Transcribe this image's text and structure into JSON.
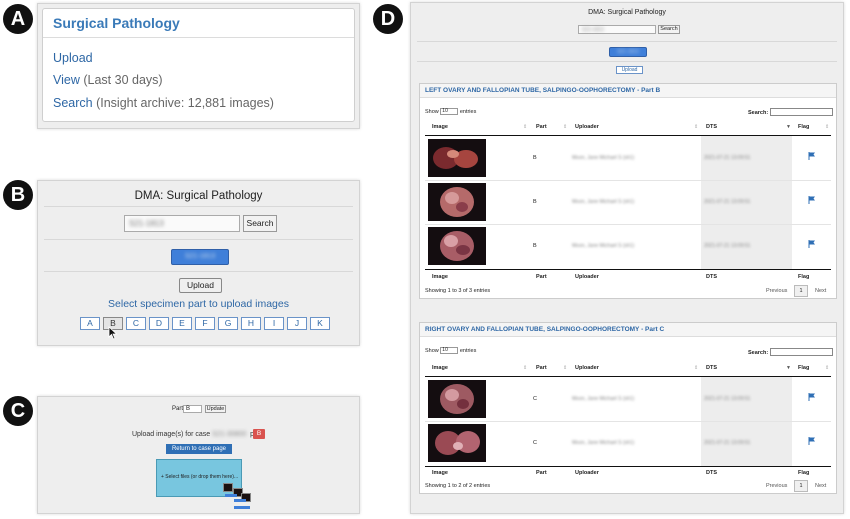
{
  "badges": [
    "A",
    "B",
    "C",
    "D"
  ],
  "panel_a": {
    "title": "Surgical Pathology",
    "upload": "Upload",
    "view": "View",
    "view_note": "(Last 30 days)",
    "search": "Search",
    "search_note": "(Insight archive: 12,881 images)"
  },
  "panel_b": {
    "title": "DMA: Surgical Pathology",
    "search_value": "S21-1813",
    "search_button": "Search",
    "case_button": "S21-1813",
    "upload_button": "Upload",
    "select_text": "Select specimen part to upload images",
    "letters": [
      "A",
      "B",
      "C",
      "D",
      "E",
      "F",
      "G",
      "H",
      "I",
      "J",
      "K"
    ],
    "selected_letter": "B"
  },
  "panel_c": {
    "part_label": "Part:",
    "part_value": "B",
    "update_button": "Update",
    "upload_prefix": "Upload image(s) for case",
    "case_id": "S21-30800",
    "upload_mid": "part",
    "part_badge": "B",
    "return_button": "Return to case page",
    "drop_text": "+ Select files (or drop them here)..."
  },
  "panel_d": {
    "title": "DMA: Surgical Pathology",
    "search_value": "S21-1813",
    "search_button": "Search",
    "case_button": "S21-1813",
    "upload_button": "Upload",
    "col_image": "Image",
    "col_part": "Part",
    "col_uploader": "Uploader",
    "col_dts": "DTS",
    "col_flag": "Flag",
    "show_label": "Show",
    "show_value": "10",
    "entries_label": "entries",
    "search_label": "Search:",
    "previous": "Previous",
    "next": "Next",
    "page": "1",
    "sections": [
      {
        "title": "LEFT OVARY AND FALLOPIAN TUBE, SALPINGO-OOPHORECTOMY - Part B",
        "rows": [
          {
            "part": "B",
            "uploader": "Moon, Jane Michael S (sh1)",
            "dts": "2021-07-21 13:09:51"
          },
          {
            "part": "B",
            "uploader": "Moon, Jane Michael S (sh1)",
            "dts": "2021-07-21 13:09:51"
          },
          {
            "part": "B",
            "uploader": "Moon, Jane Michael S (sh1)",
            "dts": "2021-07-21 13:09:51"
          }
        ],
        "info": "Showing 1 to 3 of 3 entries"
      },
      {
        "title": "RIGHT OVARY AND FALLOPIAN TUBE, SALPINGO-OOPHORECTOMY - Part C",
        "rows": [
          {
            "part": "C",
            "uploader": "Moon, Jane Michael S (sh1)",
            "dts": "2021-07-21 13:09:51"
          },
          {
            "part": "C",
            "uploader": "Moon, Jane Michael S (sh1)",
            "dts": "2021-07-21 13:09:51"
          }
        ],
        "info": "Showing 1 to 2 of 2 entries"
      }
    ]
  },
  "colors": {
    "link": "#2e67a5",
    "flag": "#2f6fb5",
    "primary": "#3f7fd9",
    "danger": "#d9534f",
    "dropzone": "#78c6df"
  }
}
